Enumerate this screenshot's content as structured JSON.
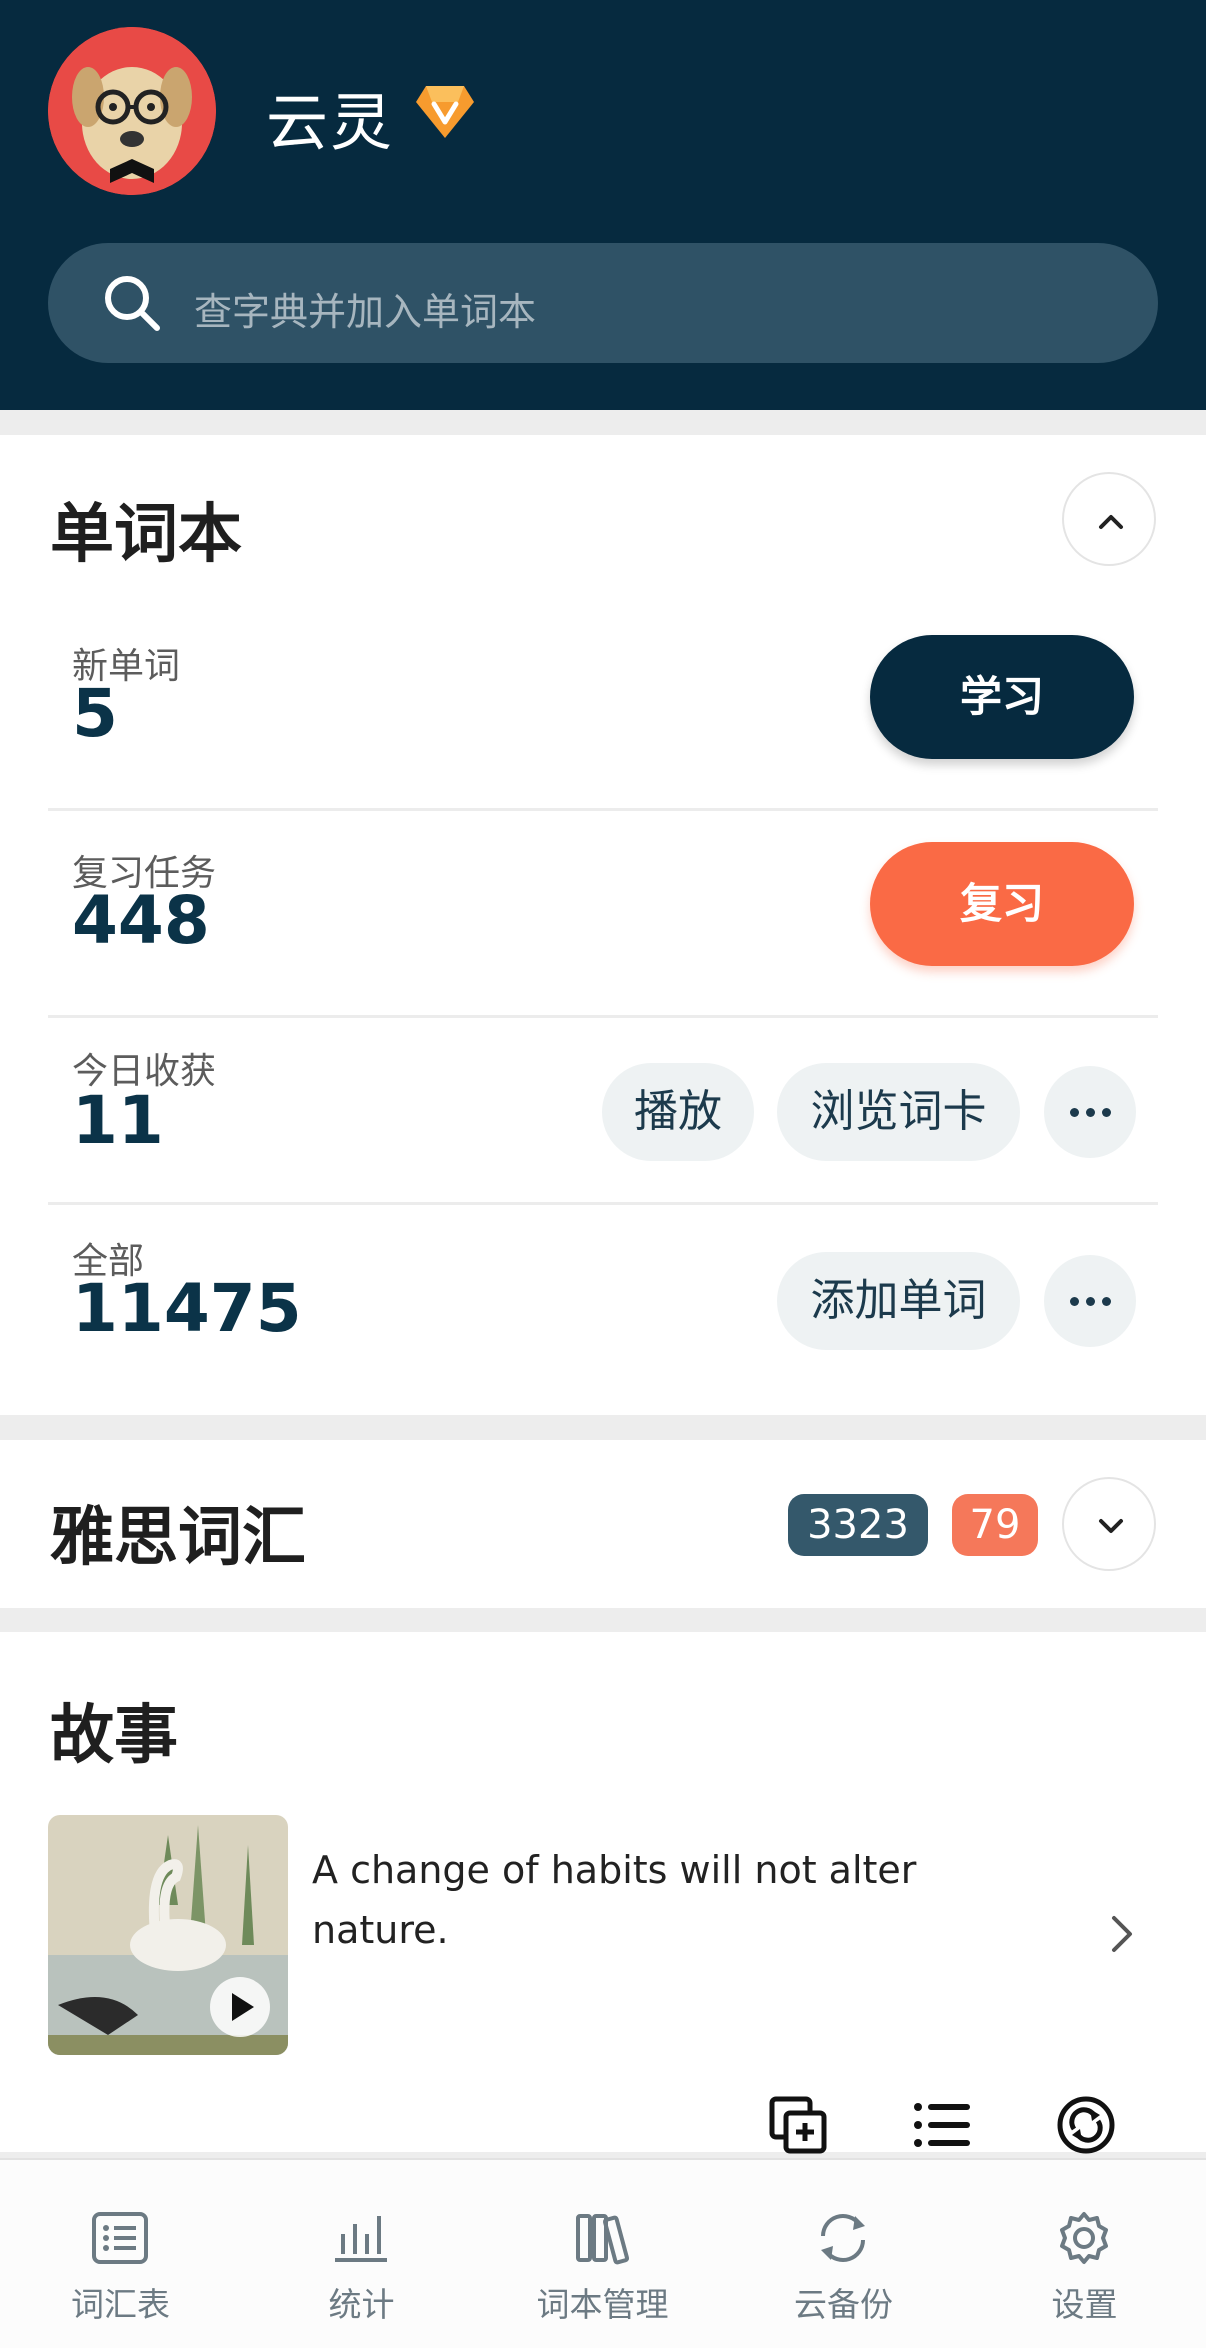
{
  "header": {
    "username": "云灵",
    "search_placeholder": "查字典并加入单词本"
  },
  "wordbook": {
    "title": "单词本",
    "rows": [
      {
        "label": "新单词",
        "value": "5",
        "action": "学习"
      },
      {
        "label": "复习任务",
        "value": "448",
        "action": "复习"
      },
      {
        "label": "今日收获",
        "value": "11",
        "actions": [
          "播放",
          "浏览词卡"
        ]
      },
      {
        "label": "全部",
        "value": "11475",
        "actions": [
          "添加单词"
        ]
      }
    ]
  },
  "ielts": {
    "title": "雅思词汇",
    "badge_total": "3323",
    "badge_due": "79",
    "colors": {
      "total": "#34586b",
      "due": "#f5785a"
    }
  },
  "story": {
    "title": "故事",
    "text": "A change of habits will not alter nature."
  },
  "nav": {
    "items": [
      {
        "label": "词汇表",
        "icon": "list-icon"
      },
      {
        "label": "统计",
        "icon": "bar-chart-icon"
      },
      {
        "label": "词本管理",
        "icon": "books-icon"
      },
      {
        "label": "云备份",
        "icon": "sync-icon"
      },
      {
        "label": "设置",
        "icon": "gear-icon"
      }
    ]
  },
  "colors": {
    "header_bg": "#062a3f",
    "accent_orange": "#fa6a45"
  }
}
